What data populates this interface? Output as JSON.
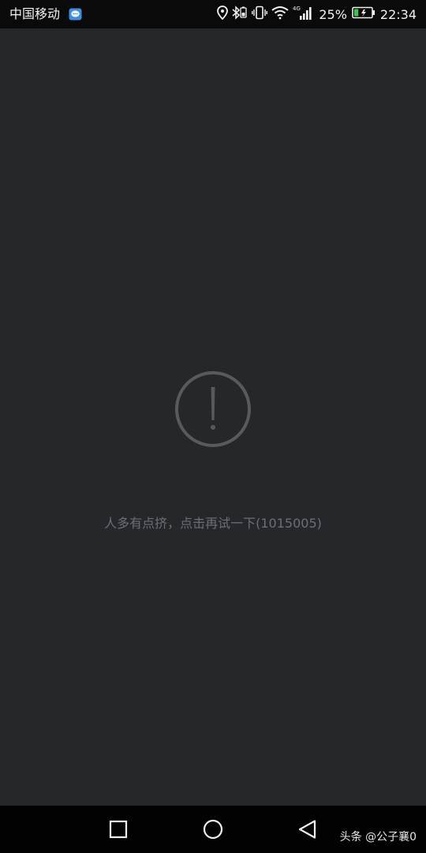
{
  "status_bar": {
    "carrier": "中国移动",
    "network_type": "4G",
    "battery_percent": "25%",
    "time": "22:34",
    "icons": [
      "notification-app-icon",
      "location-icon",
      "bluetooth-icon",
      "vibrate-icon",
      "wifi-icon",
      "signal-icon",
      "battery-charging-icon"
    ],
    "battery_level": 0.25,
    "battery_color": "#3ec44a"
  },
  "main": {
    "icon": "exclamation-circle-icon",
    "message": "人多有点挤，点击再试一下(1015005)"
  },
  "nav_bar": {
    "buttons": [
      "recent-apps",
      "home",
      "back"
    ]
  },
  "watermark": "头条 @公子襄0"
}
